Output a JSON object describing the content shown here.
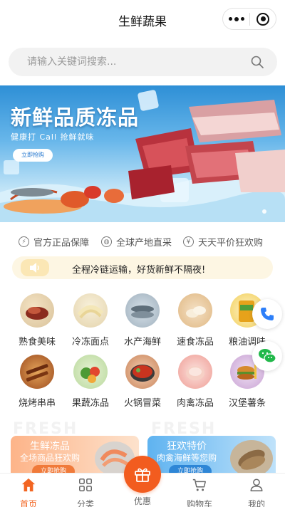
{
  "header": {
    "title": "生鲜蔬果"
  },
  "search": {
    "placeholder": "请输入关键词搜索..."
  },
  "banner": {
    "title": "新鲜品质冻品",
    "subtitle": "健康打 Call 抢鲜就味",
    "button_label": "立即抢购"
  },
  "guarantees": [
    {
      "label": "官方正品保障",
      "icon": "lightning-icon"
    },
    {
      "label": "全球产地直采",
      "icon": "globe-icon"
    },
    {
      "label": "天天平价狂欢购",
      "icon": "yen-icon"
    }
  ],
  "notice": {
    "text": "全程冷链运输，好货新鲜不隔夜!",
    "icon": "speaker-icon"
  },
  "categories": [
    {
      "label": "熟食美味"
    },
    {
      "label": "冷冻面点"
    },
    {
      "label": "水产海鲜"
    },
    {
      "label": "速食冻品"
    },
    {
      "label": "粮油调味"
    },
    {
      "label": "烧烤串串"
    },
    {
      "label": "果蔬冻品"
    },
    {
      "label": "火锅冒菜"
    },
    {
      "label": "肉禽冻品"
    },
    {
      "label": "汉堡薯条"
    }
  ],
  "promos": [
    {
      "ghost": "FRESH",
      "title": "生鲜冻品",
      "subtitle": "全场商品狂欢购",
      "button": "立即抢购"
    },
    {
      "ghost": "FRESH",
      "title": "狂欢特价",
      "subtitle": "肉禽海鲜等您购",
      "button": "立即抢购"
    }
  ],
  "tabbar": {
    "items": [
      {
        "label": "首页",
        "icon": "home-icon"
      },
      {
        "label": "分类",
        "icon": "grid-icon"
      },
      {
        "label": "优惠",
        "icon": "gift-icon"
      },
      {
        "label": "购物车",
        "icon": "cart-icon"
      },
      {
        "label": "我的",
        "icon": "user-icon"
      }
    ]
  },
  "colors": {
    "accent": "#f25c1f",
    "notice_bg": "#fdf6e3",
    "phone_button": "#2d7ff9",
    "wechat_button": "#21b84a"
  }
}
